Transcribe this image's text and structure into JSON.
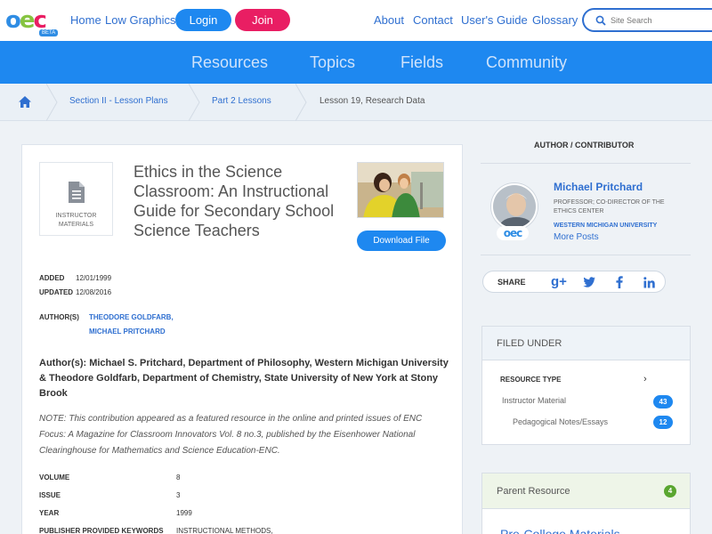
{
  "header": {
    "logo": "oec",
    "logo_badge": "BETA",
    "links": [
      "Home",
      "Low Graphics"
    ],
    "login_label": "Login",
    "join_label": "Join",
    "right_links": [
      "About",
      "Contact",
      "User's Guide",
      "Glossary"
    ],
    "search_placeholder": "Site Search"
  },
  "nav": {
    "items": [
      "Resources",
      "Topics",
      "Fields",
      "Community"
    ]
  },
  "breadcrumb": {
    "items": [
      "Section II - Lesson Plans",
      "Part 2 Lessons",
      "Lesson 19, Research Data"
    ]
  },
  "resource": {
    "type_label": "INSTRUCTOR MATERIALS",
    "title": "Ethics in the Science Classroom: An Instructional Guide for Secondary School Science Teachers",
    "download_label": "Download File",
    "added_label": "ADDED",
    "added": "12/01/1999",
    "updated_label": "UPDATED",
    "updated": "12/08/2016",
    "authors_label": "AUTHOR(S)",
    "authors": [
      "THEODORE GOLDFARB,",
      "MICHAEL PRITCHARD"
    ],
    "authors_text": "Author(s):  Michael S. Pritchard, Department of Philosophy, Western Michigan University & Theodore Goldfarb, Department of Chemistry, State University of New York at Stony Brook",
    "note": "NOTE: This contribution appeared as a featured resource in the online and printed issues of ENC Focus: A Magazine for Classroom Innovators Vol. 8 no.3, published by the Eisenhower National Clearinghouse for Mathematics and Science Education-ENC.",
    "details": [
      {
        "k": "VOLUME",
        "v": "8"
      },
      {
        "k": "ISSUE",
        "v": "3"
      },
      {
        "k": "YEAR",
        "v": "1999"
      },
      {
        "k": "PUBLISHER PROVIDED KEYWORDS",
        "v": "INSTRUCTIONAL METHODS,"
      }
    ]
  },
  "contributor": {
    "heading": "AUTHOR / CONTRIBUTOR",
    "name": "Michael Pritchard",
    "role": "PROFESSOR; CO-DIRECTOR OF THE ETHICS CENTER",
    "org": "WESTERN MICHIGAN UNIVERSITY",
    "more": "More Posts",
    "avatar_badge": "oec"
  },
  "share": {
    "label": "SHARE",
    "icons": [
      "g+",
      "twitter",
      "facebook",
      "linkedin"
    ]
  },
  "filed_under": {
    "heading": "FILED UNDER",
    "resource_type_label": "RESOURCE TYPE",
    "items": [
      {
        "label": "Instructor Material",
        "count": "43"
      },
      {
        "label": "Pedagogical Notes/Essays",
        "count": "12"
      }
    ]
  },
  "parent": {
    "heading": "Parent Resource",
    "count": "4",
    "link": "Pre-College Materials"
  },
  "colors": {
    "primary": "#1e88f0",
    "accent_pink": "#e91e63",
    "link": "#2f6fd0"
  }
}
